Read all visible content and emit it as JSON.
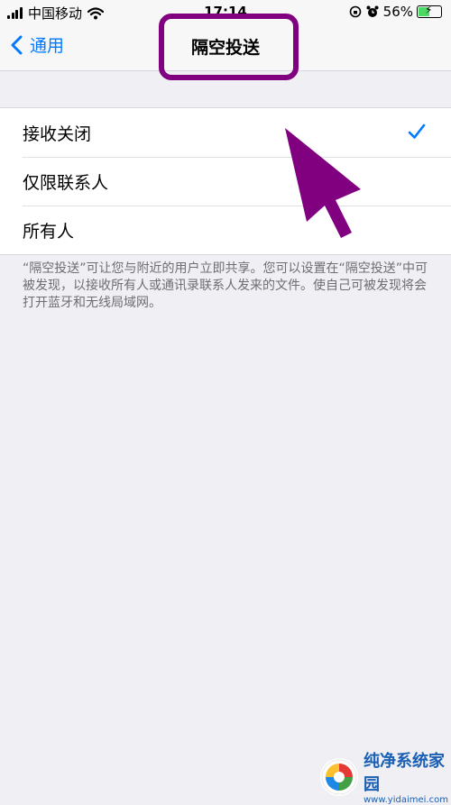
{
  "status_bar": {
    "carrier": "中国移动",
    "time": "17:14",
    "battery_percent": "56%",
    "battery_level": 0.56,
    "icons": [
      "signal-icon",
      "wifi-icon",
      "lock-rotation-icon",
      "alarm-icon",
      "battery-icon"
    ]
  },
  "nav": {
    "back_label": "通用",
    "title": "隔空投送"
  },
  "options": [
    {
      "label": "接收关闭",
      "selected": true
    },
    {
      "label": "仅限联系人",
      "selected": false
    },
    {
      "label": "所有人",
      "selected": false
    }
  ],
  "footer_note": "“隔空投送”可让您与附近的用户立即共享。您可以设置在“隔空投送”中可被发现，以接收所有人或通讯录联系人发来的文件。使自己可被发现将会打开蓝牙和无线局域网。",
  "watermark": {
    "name": "纯净系统家园",
    "url": "www.yidaimei.com"
  },
  "colors": {
    "accent": "#007aff",
    "annotation": "#800080",
    "background": "#efeff4"
  }
}
